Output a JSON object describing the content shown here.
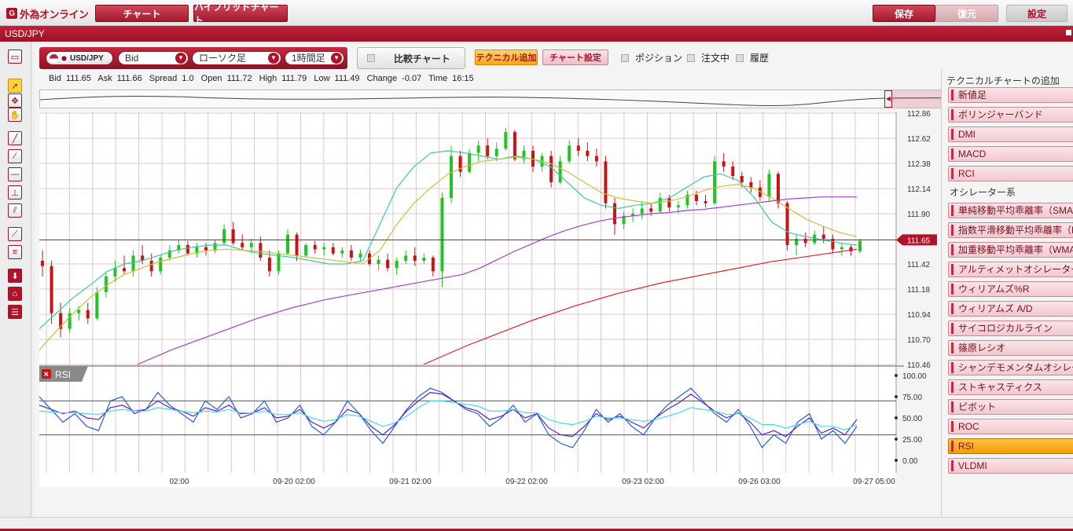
{
  "nav": {
    "logo_text": "外為オンライン",
    "chart": "チャート",
    "hybrid": "ハイブリッドチャート",
    "save": "保存",
    "restore": "復元",
    "settings": "設定"
  },
  "title": "USD/JPY",
  "toolbar": {
    "symbol": "USD/JPY",
    "price_type": "Bid",
    "chart_type": "ローソク足",
    "timeframe": "1時間足",
    "compare": "比較チャート",
    "tech_add": "テクニカル追加",
    "chart_settings": "チャート設定",
    "position": "ポジション",
    "orders": "注文中",
    "history": "履歴"
  },
  "quote": {
    "bid_label": "Bid",
    "bid": "111.65",
    "ask_label": "Ask",
    "ask": "111.66",
    "spread_label": "Spread",
    "spread": "1.0",
    "open_label": "Open",
    "open": "111.72",
    "high_label": "High",
    "high": "111.79",
    "low_label": "Low",
    "low": "111.49",
    "change_label": "Change",
    "change": "-0.07",
    "time_label": "Time",
    "time": "16:15"
  },
  "right_panel": {
    "title": "テクニカルチャートの追加",
    "items_top": [
      "新値足",
      "ボリンジャーバンド",
      "DMI",
      "MACD",
      "RCI"
    ],
    "oscillator_header": "オシレーター系",
    "items": [
      "単純移動平均乖離率（SMA）",
      "指数平滑移動平均乖離率（EMA）",
      "加重移動平均乖離率（WMA）",
      "アルティメットオシレーター",
      "ウィリアムズ%R",
      "ウィリアムズ A/D",
      "サイコロジカルライン",
      "篠原レシオ",
      "シャンデモメンタムオシレーター",
      "ストキャスティクス",
      "ピボット",
      "ROC",
      "RSI",
      "VLDMI"
    ],
    "active_item": "RSI"
  },
  "chart_data": {
    "type": "line",
    "title": "USD/JPY",
    "price_axis": {
      "ylim": [
        110.46,
        112.86
      ],
      "ticks": [
        "112.86",
        "112.62",
        "112.38",
        "112.14",
        "111.90",
        "111.65",
        "111.42",
        "111.18",
        "110.94",
        "110.70",
        "110.46"
      ],
      "current": 111.65,
      "current_label": "111.65"
    },
    "time_axis": {
      "ticks": [
        "02:00",
        "09-20 02:00",
        "09-21 02:00",
        "09-22 02:00",
        "09-23 02:00",
        "09-26 03:00",
        "09-27 05:00"
      ]
    },
    "candles": [
      [
        111.45,
        111.55,
        111.3,
        111.4
      ],
      [
        111.4,
        111.45,
        110.85,
        110.95
      ],
      [
        110.95,
        111.05,
        110.72,
        110.8
      ],
      [
        110.8,
        111.0,
        110.76,
        110.95
      ],
      [
        110.95,
        111.02,
        110.88,
        110.98
      ],
      [
        110.98,
        111.05,
        110.85,
        110.9
      ],
      [
        110.9,
        111.2,
        110.88,
        111.15
      ],
      [
        111.15,
        111.35,
        111.1,
        111.3
      ],
      [
        111.3,
        111.45,
        111.25,
        111.38
      ],
      [
        111.38,
        111.5,
        111.32,
        111.35
      ],
      [
        111.35,
        111.55,
        111.3,
        111.5
      ],
      [
        111.5,
        111.6,
        111.42,
        111.45
      ],
      [
        111.45,
        111.52,
        111.3,
        111.35
      ],
      [
        111.35,
        111.5,
        111.32,
        111.48
      ],
      [
        111.48,
        111.6,
        111.45,
        111.55
      ],
      [
        111.55,
        111.65,
        111.52,
        111.6
      ],
      [
        111.6,
        111.64,
        111.5,
        111.52
      ],
      [
        111.52,
        111.62,
        111.48,
        111.58
      ],
      [
        111.58,
        111.62,
        111.5,
        111.55
      ],
      [
        111.55,
        111.65,
        111.52,
        111.62
      ],
      [
        111.62,
        111.8,
        111.6,
        111.75
      ],
      [
        111.75,
        111.82,
        111.6,
        111.62
      ],
      [
        111.62,
        111.7,
        111.55,
        111.58
      ],
      [
        111.58,
        111.66,
        111.52,
        111.62
      ],
      [
        111.62,
        111.68,
        111.45,
        111.48
      ],
      [
        111.48,
        111.55,
        111.3,
        111.35
      ],
      [
        111.35,
        111.55,
        111.32,
        111.52
      ],
      [
        111.52,
        111.75,
        111.5,
        111.7
      ],
      [
        111.7,
        111.72,
        111.45,
        111.5
      ],
      [
        111.5,
        111.62,
        111.48,
        111.6
      ],
      [
        111.6,
        111.64,
        111.52,
        111.56
      ],
      [
        111.56,
        111.62,
        111.5,
        111.58
      ],
      [
        111.58,
        111.62,
        111.5,
        111.52
      ],
      [
        111.52,
        111.58,
        111.48,
        111.55
      ],
      [
        111.55,
        111.6,
        111.45,
        111.48
      ],
      [
        111.48,
        111.56,
        111.44,
        111.52
      ],
      [
        111.52,
        111.55,
        111.4,
        111.42
      ],
      [
        111.42,
        111.5,
        111.36,
        111.46
      ],
      [
        111.46,
        111.52,
        111.35,
        111.38
      ],
      [
        111.38,
        111.48,
        111.32,
        111.45
      ],
      [
        111.45,
        111.55,
        111.42,
        111.5
      ],
      [
        111.5,
        111.58,
        111.4,
        111.45
      ],
      [
        111.45,
        111.52,
        111.42,
        111.48
      ],
      [
        111.48,
        111.5,
        111.3,
        111.35
      ],
      [
        111.35,
        112.1,
        111.2,
        112.05
      ],
      [
        112.05,
        112.55,
        112.0,
        112.45
      ],
      [
        112.45,
        112.5,
        112.25,
        112.3
      ],
      [
        112.3,
        112.52,
        112.28,
        112.48
      ],
      [
        112.48,
        112.6,
        112.4,
        112.55
      ],
      [
        112.55,
        112.62,
        112.42,
        112.45
      ],
      [
        112.45,
        112.58,
        112.4,
        112.52
      ],
      [
        112.52,
        112.72,
        112.5,
        112.68
      ],
      [
        112.68,
        112.7,
        112.4,
        112.42
      ],
      [
        112.42,
        112.55,
        112.38,
        112.5
      ],
      [
        112.5,
        112.55,
        112.3,
        112.35
      ],
      [
        112.35,
        112.48,
        112.3,
        112.45
      ],
      [
        112.45,
        112.5,
        112.15,
        112.2
      ],
      [
        112.2,
        112.45,
        112.18,
        112.4
      ],
      [
        112.4,
        112.6,
        112.38,
        112.55
      ],
      [
        112.55,
        112.62,
        112.45,
        112.5
      ],
      [
        112.5,
        112.58,
        112.4,
        112.45
      ],
      [
        112.45,
        112.52,
        112.35,
        112.4
      ],
      [
        112.4,
        112.45,
        111.95,
        112.0
      ],
      [
        112.0,
        112.05,
        111.7,
        111.8
      ],
      [
        111.8,
        111.92,
        111.75,
        111.88
      ],
      [
        111.88,
        111.95,
        111.82,
        111.9
      ],
      [
        111.9,
        112.02,
        111.85,
        111.95
      ],
      [
        111.95,
        112.0,
        111.88,
        111.92
      ],
      [
        111.92,
        112.1,
        111.9,
        112.05
      ],
      [
        112.05,
        112.08,
        111.92,
        111.96
      ],
      [
        111.96,
        112.02,
        111.9,
        111.98
      ],
      [
        111.98,
        112.12,
        111.95,
        112.08
      ],
      [
        112.08,
        112.12,
        111.98,
        112.02
      ],
      [
        112.02,
        112.08,
        111.96,
        112.0
      ],
      [
        112.0,
        112.45,
        111.98,
        112.4
      ],
      [
        112.4,
        112.48,
        112.3,
        112.35
      ],
      [
        112.35,
        112.4,
        112.22,
        112.26
      ],
      [
        112.26,
        112.3,
        112.15,
        112.2
      ],
      [
        112.2,
        112.25,
        112.1,
        112.15
      ],
      [
        112.15,
        112.22,
        112.02,
        112.06
      ],
      [
        112.06,
        112.32,
        112.02,
        112.28
      ],
      [
        112.28,
        112.3,
        111.95,
        112.0
      ],
      [
        112.0,
        112.02,
        111.55,
        111.6
      ],
      [
        111.6,
        111.7,
        111.5,
        111.66
      ],
      [
        111.66,
        111.72,
        111.58,
        111.62
      ],
      [
        111.62,
        111.74,
        111.6,
        111.7
      ],
      [
        111.7,
        111.78,
        111.62,
        111.66
      ],
      [
        111.66,
        111.7,
        111.52,
        111.56
      ],
      [
        111.56,
        111.62,
        111.5,
        111.58
      ],
      [
        111.58,
        111.6,
        111.5,
        111.54
      ],
      [
        111.54,
        111.66,
        111.52,
        111.64
      ]
    ],
    "series": [
      {
        "name": "SMA short",
        "color": "#3cc8a0",
        "values": [
          110.8,
          110.95,
          111.1,
          111.22,
          111.35,
          111.42,
          111.45,
          111.5,
          111.55,
          111.58,
          111.6,
          111.6,
          111.55,
          111.52,
          111.5,
          111.48,
          111.45,
          111.42,
          111.42,
          111.45,
          111.8,
          112.15,
          112.35,
          112.48,
          112.5,
          112.48,
          112.45,
          112.42,
          112.45,
          112.42,
          112.35,
          112.2,
          112.05,
          111.98,
          111.95,
          111.98,
          112.0,
          112.05,
          112.15,
          112.25,
          112.28,
          112.22,
          112.05,
          111.82,
          111.72,
          111.68,
          111.65,
          111.62,
          111.6
        ]
      },
      {
        "name": "SMA mid",
        "color": "#c8c040",
        "values": [
          110.6,
          110.78,
          110.95,
          111.1,
          111.22,
          111.32,
          111.38,
          111.44,
          111.48,
          111.52,
          111.55,
          111.56,
          111.55,
          111.54,
          111.52,
          111.5,
          111.48,
          111.46,
          111.44,
          111.42,
          111.55,
          111.8,
          112.0,
          112.15,
          112.28,
          112.35,
          112.4,
          112.42,
          112.44,
          112.42,
          112.38,
          112.3,
          112.2,
          112.1,
          112.05,
          112.02,
          112.0,
          112.02,
          112.06,
          112.12,
          112.16,
          112.18,
          112.14,
          112.05,
          111.95,
          111.85,
          111.78,
          111.72,
          111.68
        ]
      },
      {
        "name": "SMA long",
        "color": "#a040d0",
        "values": [
          110.46,
          110.53,
          110.6,
          110.66,
          110.72,
          110.78,
          110.84,
          110.9,
          110.95,
          111.0,
          111.04,
          111.08,
          111.11,
          111.14,
          111.17,
          111.2,
          111.23,
          111.26,
          111.29,
          111.32,
          111.38,
          111.46,
          111.54,
          111.61,
          111.68,
          111.74,
          111.79,
          111.83,
          111.86,
          111.88,
          111.9,
          111.91,
          111.93,
          111.94,
          111.96,
          111.98,
          112.0,
          112.02,
          112.04,
          112.05,
          112.06,
          112.06,
          112.06
        ]
      },
      {
        "name": "SMA longer",
        "color": "#e02020",
        "values": [
          110.46,
          110.55,
          110.64,
          110.72,
          110.8,
          110.88,
          110.95,
          111.02,
          111.08,
          111.14,
          111.19,
          111.24,
          111.28,
          111.32,
          111.36,
          111.4,
          111.44,
          111.47,
          111.5,
          111.53,
          111.56
        ]
      }
    ],
    "rsi": {
      "label": "RSI",
      "ylim": [
        0,
        100
      ],
      "ticks": [
        "100.00",
        "75.00",
        "50.00",
        "25.00",
        "0.00"
      ],
      "levels": [
        70,
        30
      ],
      "series": [
        {
          "name": "RSI fast",
          "color": "#2060e0",
          "values": [
            75,
            60,
            45,
            55,
            40,
            35,
            70,
            75,
            55,
            60,
            80,
            65,
            55,
            45,
            70,
            60,
            75,
            50,
            55,
            70,
            45,
            50,
            65,
            40,
            30,
            45,
            70,
            55,
            35,
            20,
            40,
            60,
            75,
            85,
            80,
            70,
            60,
            55,
            40,
            50,
            65,
            45,
            55,
            30,
            20,
            15,
            35,
            60,
            45,
            55,
            40,
            30,
            50,
            65,
            75,
            85,
            70,
            55,
            45,
            60,
            40,
            15,
            30,
            20,
            45,
            55,
            25,
            35,
            20,
            40
          ]
        },
        {
          "name": "RSI mid",
          "color": "#6020c0",
          "values": [
            65,
            60,
            55,
            58,
            50,
            48,
            62,
            65,
            58,
            60,
            70,
            62,
            58,
            52,
            62,
            58,
            65,
            55,
            56,
            62,
            50,
            52,
            60,
            45,
            38,
            45,
            60,
            55,
            40,
            30,
            42,
            58,
            70,
            80,
            78,
            70,
            62,
            58,
            48,
            52,
            60,
            50,
            55,
            38,
            30,
            28,
            40,
            55,
            48,
            52,
            45,
            38,
            50,
            60,
            68,
            78,
            68,
            58,
            50,
            56,
            45,
            30,
            35,
            28,
            40,
            50,
            32,
            38,
            30,
            48
          ]
        },
        {
          "name": "RSI slow",
          "color": "#40e0e0",
          "values": [
            58,
            57,
            56,
            56,
            55,
            54,
            58,
            60,
            58,
            58,
            62,
            60,
            58,
            56,
            58,
            57,
            60,
            56,
            56,
            58,
            54,
            54,
            56,
            50,
            46,
            48,
            54,
            52,
            46,
            40,
            44,
            52,
            62,
            70,
            70,
            68,
            66,
            64,
            58,
            58,
            60,
            56,
            56,
            48,
            44,
            42,
            46,
            52,
            50,
            50,
            48,
            46,
            48,
            52,
            56,
            62,
            60,
            58,
            54,
            55,
            50,
            42,
            42,
            38,
            42,
            46,
            40,
            40,
            36,
            42
          ]
        }
      ]
    }
  }
}
